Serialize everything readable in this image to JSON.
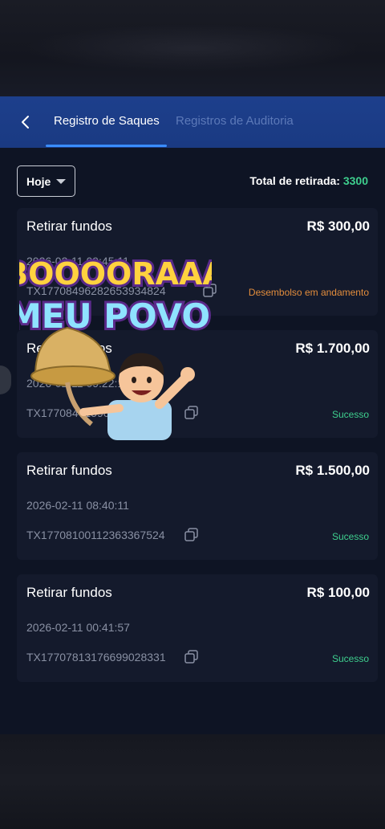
{
  "header": {
    "tabs": [
      {
        "label": "Registro de Saques",
        "active": true
      },
      {
        "label": "Registros de Auditoria",
        "active": false
      }
    ]
  },
  "filter": {
    "selected": "Hoje"
  },
  "summary": {
    "total_label": "Total de retirada: ",
    "total_value": "3300"
  },
  "records": [
    {
      "title": "Retirar fundos",
      "amount": "R$ 300,00",
      "date": "2026-02-11 09:45:11",
      "tx": "TX17708496282653934824",
      "status": "Desembolso em andamento",
      "status_type": "pending"
    },
    {
      "title": "Retirar fundos",
      "amount": "R$ 1.700,00",
      "date": "2026-02-11 09:22:15",
      "tx": "TX17708471590562663522",
      "status": "Sucesso",
      "status_type": "success"
    },
    {
      "title": "Retirar fundos",
      "amount": "R$ 1.500,00",
      "date": "2026-02-11 08:40:11",
      "tx": "TX17708100112363367524",
      "status": "Sucesso",
      "status_type": "success"
    },
    {
      "title": "Retirar fundos",
      "amount": "R$ 100,00",
      "date": "2026-02-11 00:41:57",
      "tx": "TX17707813176699028331",
      "status": "Sucesso",
      "status_type": "success"
    }
  ],
  "sticker": {
    "line1": "BOOOORAAA",
    "line2": "MEU POVO"
  },
  "colors": {
    "header_bg": "#1d3f8c",
    "accent_blue": "#3a8dff",
    "success": "#3ecf8e",
    "pending": "#e38d3c",
    "card_bg": "#141a2c"
  }
}
